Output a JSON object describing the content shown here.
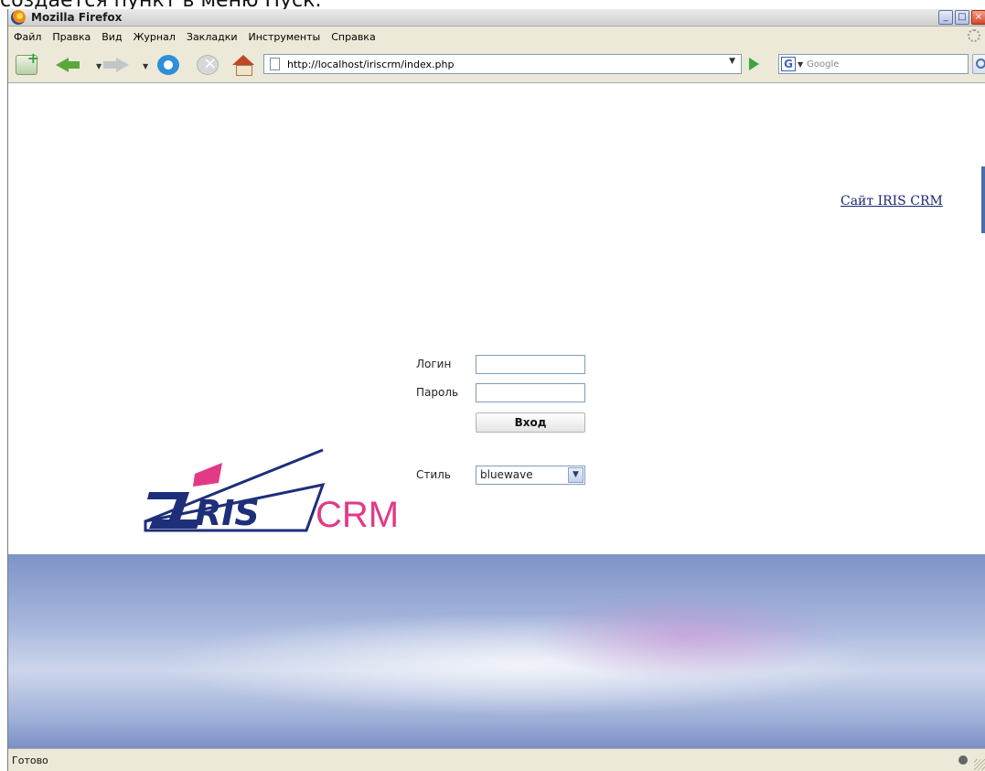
{
  "caption": "создается пункт в меню Пуск.",
  "browser": {
    "title": "Mozilla Firefox",
    "window_controls": {
      "minimize": "_",
      "maximize": "□",
      "close": "×"
    },
    "menu": [
      "Файл",
      "Правка",
      "Вид",
      "Журнал",
      "Закладки",
      "Инструменты",
      "Справка"
    ],
    "url": "http://localhost/iriscrm/index.php",
    "search_engine_letter": "G",
    "search_placeholder": "Google",
    "status": "Готово"
  },
  "icons": {
    "newtab": "new-tab-icon",
    "back": "back-arrow-icon",
    "forward": "forward-arrow-icon",
    "reload": "reload-icon",
    "stop": "stop-icon",
    "home": "home-icon",
    "page": "page-icon",
    "go": "go-arrow-icon",
    "search": "magnifier-icon",
    "throbber": "throbber-icon"
  },
  "page": {
    "site_link": "Сайт IRIS CRM",
    "login_label": "Логин",
    "password_label": "Пароль",
    "login_value": "",
    "password_value": "",
    "enter_button": "Вход",
    "style_label": "Стиль",
    "style_value": "bluewave",
    "logo": {
      "iris": "RIS",
      "crm": "CRM"
    }
  },
  "colors": {
    "logo_blue": "#1e2f7a",
    "logo_pink": "#e23a86",
    "link": "#1b2770",
    "banner_blue": "#7f93c6"
  }
}
